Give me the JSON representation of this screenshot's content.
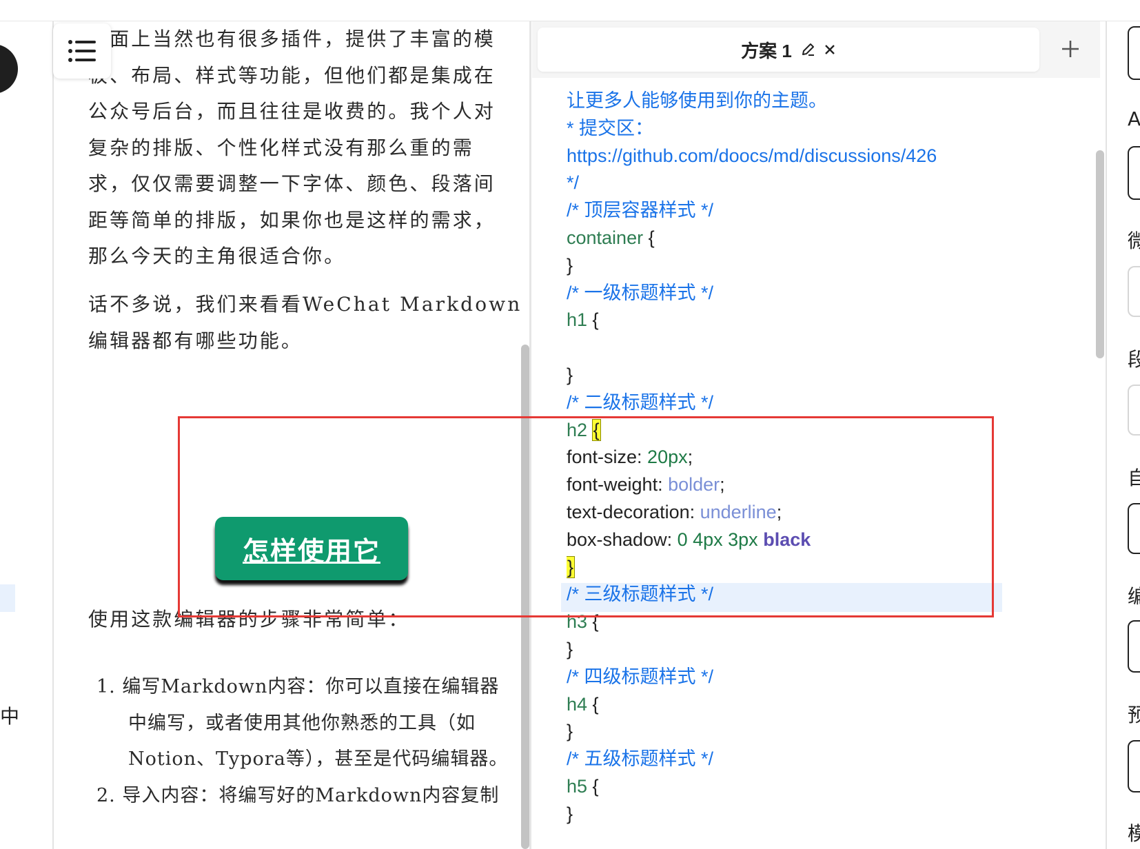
{
  "preview": {
    "para1_lines": [
      "市面上当然也有很多插件，提供了丰富的模",
      "板、布局、样式等功能，但他们都是集成在",
      "公众号后台，而且往往是收费的。我个人对",
      "复杂的排版、个性化样式没有那么重的需",
      "求，仅仅需要调整一下字体、颜色、段落间",
      "距等简单的排版，如果你也是这样的需求，",
      "那么今天的主角很适合你。"
    ],
    "para2_lines": [
      "话不多说，我们来看看WeChat Markdown",
      "编辑器都有哪些功能。"
    ],
    "heading": "怎样使用它",
    "para3": "使用这款编辑器的步骤非常简单：",
    "list_lines": [
      "1. 编写Markdown内容：你可以直接在编辑器",
      "中编写，或者使用其他你熟悉的工具（如",
      "Notion、Typora等），甚至是代码编辑器。",
      "2. 导入内容：将编写好的Markdown内容复制"
    ]
  },
  "left_sidebar": {
    "partial_glyph": "中"
  },
  "editor": {
    "tab_label": "方案 1",
    "code_lines": [
      {
        "segs": [
          {
            "t": "让更多人能够使用到你的主题。",
            "c": "cm"
          }
        ]
      },
      {
        "segs": [
          {
            "t": " * 提交区：",
            "c": "cm"
          }
        ]
      },
      {
        "segs": [
          {
            "t": "https://github.com/doocs/md/discussions/426",
            "c": "cm"
          }
        ]
      },
      {
        "segs": [
          {
            "t": " */",
            "c": "cm"
          }
        ]
      },
      {
        "segs": [
          {
            "t": "/* 顶层容器样式 */",
            "c": "cm"
          }
        ]
      },
      {
        "segs": [
          {
            "t": "container",
            "c": "sel"
          },
          {
            "t": " {",
            "c": ""
          }
        ]
      },
      {
        "segs": [
          {
            "t": "}",
            "c": ""
          }
        ]
      },
      {
        "segs": [
          {
            "t": "/* 一级标题样式 */",
            "c": "cm"
          }
        ]
      },
      {
        "segs": [
          {
            "t": "h1",
            "c": "sel"
          },
          {
            "t": " {",
            "c": ""
          }
        ]
      },
      {
        "segs": []
      },
      {
        "segs": [
          {
            "t": "}",
            "c": ""
          }
        ]
      },
      {
        "segs": [
          {
            "t": "/* 二级标题样式 */",
            "c": "cm"
          }
        ]
      },
      {
        "segs": [
          {
            "t": "h2",
            "c": "sel"
          },
          {
            "t": " ",
            "c": ""
          },
          {
            "t": "{",
            "c": "bracket-hl"
          }
        ]
      },
      {
        "segs": [
          {
            "t": "  font-size: ",
            "c": ""
          },
          {
            "t": "20px",
            "c": "num"
          },
          {
            "t": ";",
            "c": ""
          }
        ]
      },
      {
        "segs": [
          {
            "t": "  font-weight: ",
            "c": ""
          },
          {
            "t": "bolder",
            "c": "kw"
          },
          {
            "t": ";",
            "c": ""
          }
        ]
      },
      {
        "segs": [
          {
            "t": "  text-decoration: ",
            "c": ""
          },
          {
            "t": "underline",
            "c": "kw"
          },
          {
            "t": ";",
            "c": ""
          }
        ]
      },
      {
        "segs": [
          {
            "t": "  box-shadow: ",
            "c": ""
          },
          {
            "t": "0 4px 3px",
            "c": "num"
          },
          {
            "t": " ",
            "c": ""
          },
          {
            "t": "black",
            "c": "kwb"
          }
        ]
      },
      {
        "segs": [
          {
            "t": "}",
            "c": "bracket-hl"
          }
        ]
      },
      {
        "segs": [
          {
            "t": "/* 三级标题样式 */",
            "c": "cm"
          }
        ]
      },
      {
        "segs": [
          {
            "t": "h3",
            "c": "sel"
          },
          {
            "t": " {",
            "c": ""
          }
        ]
      },
      {
        "segs": [
          {
            "t": "}",
            "c": ""
          }
        ]
      },
      {
        "segs": [
          {
            "t": "/* 四级标题样式 */",
            "c": "cm"
          }
        ]
      },
      {
        "segs": [
          {
            "t": "h4",
            "c": "sel"
          },
          {
            "t": " {",
            "c": ""
          }
        ]
      },
      {
        "segs": [
          {
            "t": "}",
            "c": ""
          }
        ]
      },
      {
        "segs": [
          {
            "t": "/* 五级标题样式 */",
            "c": "cm"
          }
        ]
      },
      {
        "segs": [
          {
            "t": "h5",
            "c": "sel"
          },
          {
            "t": " {",
            "c": ""
          }
        ]
      },
      {
        "segs": [
          {
            "t": "}",
            "c": ""
          }
        ]
      }
    ]
  },
  "right_panel": {
    "labels": [
      "A",
      "微",
      "段",
      "自",
      "编",
      "预",
      "模"
    ]
  }
}
